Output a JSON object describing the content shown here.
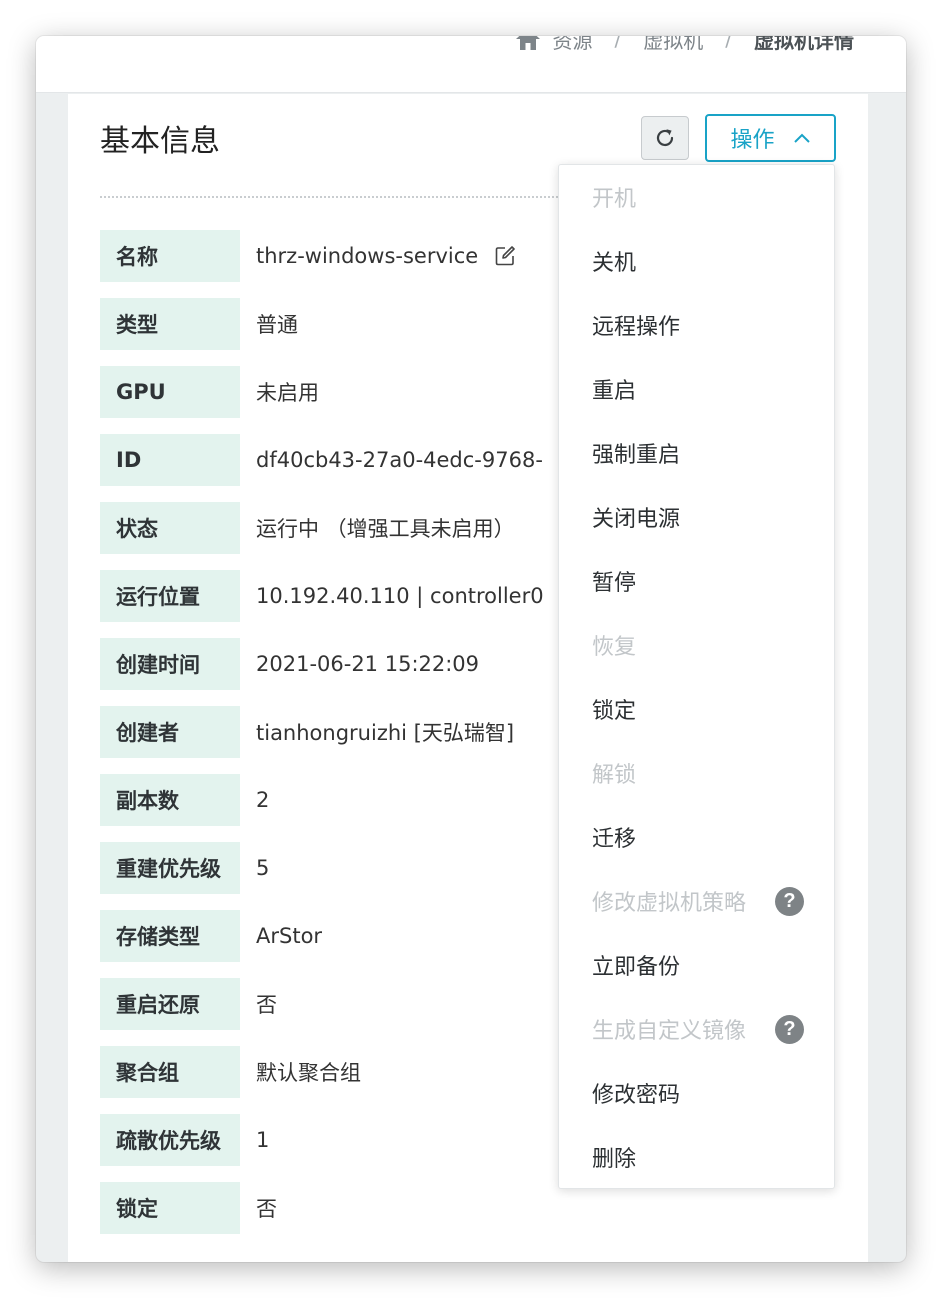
{
  "breadcrumb": {
    "items": [
      "资源",
      "虚拟机",
      "虚拟机详情"
    ],
    "separator": "/"
  },
  "card": {
    "title": "基本信息",
    "ops_button_label": "操作"
  },
  "details": [
    {
      "label": "名称",
      "value": "thrz-windows-service"
    },
    {
      "label": "类型",
      "value": "普通"
    },
    {
      "label": "GPU",
      "value": "未启用"
    },
    {
      "label": "ID",
      "value": "df40cb43-27a0-4edc-9768-"
    },
    {
      "label": "状态",
      "value": "运行中 （增强工具未启用）"
    },
    {
      "label": "运行位置",
      "value": "10.192.40.110 | controller0"
    },
    {
      "label": "创建时间",
      "value": "2021-06-21 15:22:09"
    },
    {
      "label": "创建者",
      "value": "tianhongruizhi [天弘瑞智]"
    },
    {
      "label": "副本数",
      "value": "2"
    },
    {
      "label": "重建优先级",
      "value": "5"
    },
    {
      "label": "存储类型",
      "value": "ArStor"
    },
    {
      "label": "重启还原",
      "value": "否"
    },
    {
      "label": "聚合组",
      "value": "默认聚合组"
    },
    {
      "label": "疏散优先级",
      "value": "1"
    },
    {
      "label": "锁定",
      "value": "否"
    }
  ],
  "menu": [
    {
      "label": "开机",
      "disabled": true
    },
    {
      "label": "关机",
      "disabled": false
    },
    {
      "label": "远程操作",
      "disabled": false
    },
    {
      "label": "重启",
      "disabled": false
    },
    {
      "label": "强制重启",
      "disabled": false
    },
    {
      "label": "关闭电源",
      "disabled": false
    },
    {
      "label": "暂停",
      "disabled": false
    },
    {
      "label": "恢复",
      "disabled": true
    },
    {
      "label": "锁定",
      "disabled": false
    },
    {
      "label": "解锁",
      "disabled": true
    },
    {
      "label": "迁移",
      "disabled": false
    },
    {
      "label": "修改虚拟机策略",
      "disabled": true,
      "help": "?"
    },
    {
      "label": "立即备份",
      "disabled": false
    },
    {
      "label": "生成自定义镜像",
      "disabled": true,
      "help": "?"
    },
    {
      "label": "修改密码",
      "disabled": false
    },
    {
      "label": "删除",
      "disabled": false
    }
  ],
  "icons": {
    "home": "home-icon",
    "refresh": "refresh-icon",
    "chevron": "chevron-up-icon",
    "edit": "edit-icon",
    "help": "help-icon"
  },
  "colors": {
    "accent": "#19a3c7",
    "label_bg": "#e3f3ee",
    "disabled_text": "#c2c6c9",
    "page_bg": "#eceff0"
  }
}
